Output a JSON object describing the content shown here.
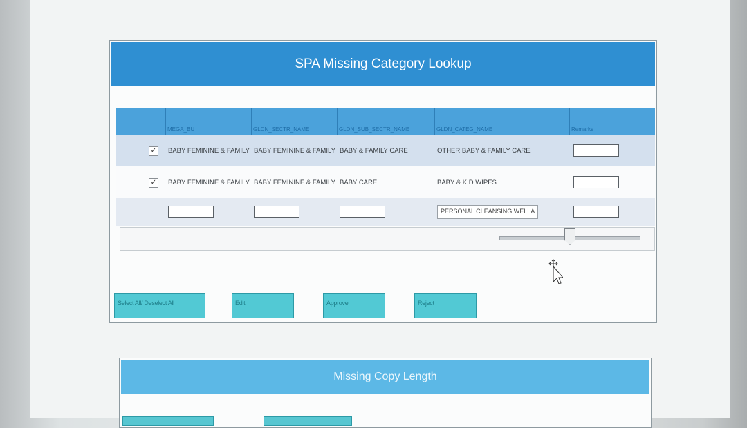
{
  "panel": {
    "title": "SPA Missing Category Lookup",
    "columns": [
      "MEGA_BU",
      "GLDN_SECTR_NAME",
      "GLDN_SUB_SECTR_NAME",
      "GLDN_CATEG_NAME",
      "Remarks"
    ],
    "rows": [
      {
        "checked": "✓",
        "mega_bu": "BABY FEMININE & FAMILY",
        "sectr": "BABY FEMININE & FAMILY",
        "sub_sectr": "BABY & FAMILY CARE",
        "categ": "OTHER BABY & FAMILY CARE"
      },
      {
        "checked": "✓",
        "mega_bu": "BABY FEMININE & FAMILY",
        "sectr": "BABY FEMININE & FAMILY",
        "sub_sectr": "BABY CARE",
        "categ": "BABY & KID WIPES"
      }
    ],
    "edit_row": {
      "categ_value": "PERSONAL CLEANSING WELLA"
    },
    "slider": {
      "position": 0.5
    },
    "buttons": {
      "select_all": "Select All/ Deselect All",
      "edit": "Edit",
      "approve": "Approve",
      "reject": "Reject"
    }
  },
  "panel2": {
    "title": "Missing Copy Length"
  }
}
